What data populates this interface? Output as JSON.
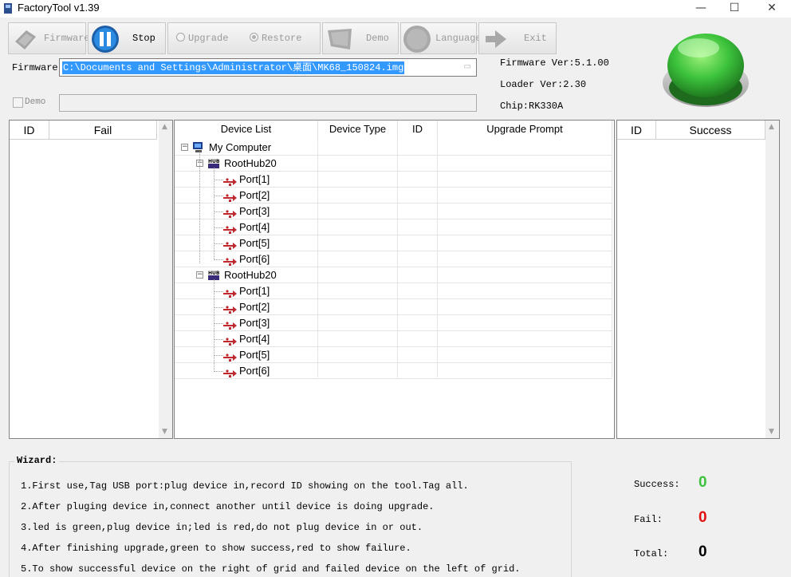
{
  "window": {
    "title": "FactoryTool v1.39",
    "min": "—",
    "max": "☐",
    "close": "✕"
  },
  "toolbar": {
    "firmware_label": "Firmware",
    "stop_label": "Stop",
    "upgrade_label": "Upgrade",
    "restore_label": "Restore",
    "demo_label": "Demo",
    "language_label": "Language",
    "exit_label": "Exit",
    "mode_selected": "Restore"
  },
  "firmware": {
    "label": "Firmware",
    "path": "C:\\Documents and Settings\\Administrator\\桌面\\MK68_150824.img",
    "demo_label": "Demo",
    "demo_value": ""
  },
  "info": {
    "firmware_ver": "Firmware Ver:5.1.00",
    "loader_ver": "Loader Ver:2.30",
    "chip": "Chip:RK330A"
  },
  "status_light_color": "#3cc23c",
  "fail_table": {
    "col_id": "ID",
    "col_fail": "Fail"
  },
  "success_table": {
    "col_id": "ID",
    "col_success": "Success"
  },
  "device_grid": {
    "columns": [
      "Device List",
      "Device Type",
      "ID",
      "Upgrade Prompt"
    ],
    "root": "My Computer",
    "hubs": [
      {
        "name": "RootHub20",
        "ports": [
          "Port[1]",
          "Port[2]",
          "Port[3]",
          "Port[4]",
          "Port[5]",
          "Port[6]"
        ]
      },
      {
        "name": "RootHub20",
        "ports": [
          "Port[1]",
          "Port[2]",
          "Port[3]",
          "Port[4]",
          "Port[5]",
          "Port[6]"
        ]
      }
    ]
  },
  "wizard": {
    "title": "Wizard:",
    "lines": [
      "1.First use,Tag USB port:plug device in,record ID showing on the tool.Tag all.",
      "2.After pluging device in,connect another until device is doing upgrade.",
      "3.led is green,plug device in;led is red,do not plug device in or out.",
      "4.After finishing upgrade,green to show success,red to show failure.",
      "5.To show successful device on the right of grid and failed device on the left of grid."
    ]
  },
  "stats": {
    "success_label": "Success:",
    "success_value": "0",
    "success_color": "#3cc23c",
    "fail_label": "Fail:",
    "fail_value": "0",
    "fail_color": "#e01010",
    "total_label": "Total:",
    "total_value": "0",
    "total_color": "#000000"
  }
}
